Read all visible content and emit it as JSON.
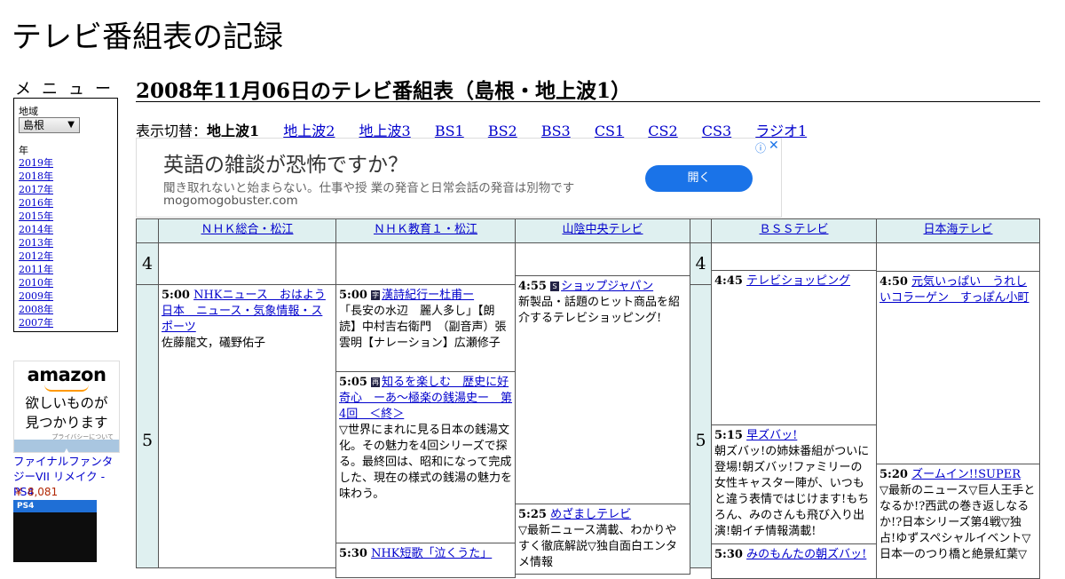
{
  "site_title": "テレビ番組表の記録",
  "sidebar": {
    "menu_heading": "メニュー",
    "region_label": "地域",
    "region_value": "島根",
    "year_label": "年",
    "years": [
      "2019年",
      "2018年",
      "2017年",
      "2016年",
      "2015年",
      "2014年",
      "2013年",
      "2012年",
      "2011年",
      "2010年",
      "2009年",
      "2008年",
      "2007年"
    ]
  },
  "amazon_ad": {
    "logo": "amazon",
    "copy_line1": "欲しいものが",
    "copy_line2": "見つかります",
    "privacy": "プライバシーについて",
    "product_title": "ファイナルファンタジーVII リメイク - PS4",
    "product_price": "￥ 8,081",
    "product_badge": "PS4"
  },
  "page_heading": "2008年11月06日のテレビ番組表（島根・地上波1）",
  "switcher": {
    "label": "表示切替：",
    "current": "地上波1",
    "links": [
      "地上波2",
      "地上波3",
      "BS1",
      "BS2",
      "BS3",
      "CS1",
      "CS2",
      "CS3",
      "ラジオ1"
    ]
  },
  "banner_ad": {
    "headline": "英語の雑談が恐怖ですか？",
    "description": "聞き取れないと始まらない。仕事や授 業の発音と日常会話の発音は別物です",
    "domain": "mogomogobuster.com",
    "button": "開く",
    "info_icon": "ⓘ",
    "close_icon": "✕"
  },
  "schedule": {
    "hours": [
      "4",
      "5"
    ],
    "channels": [
      "ＮＨＫ総合・松江",
      "ＮＨＫ教育１・松江",
      "山陰中央テレビ",
      "ＢＳＳテレビ",
      "日本海テレビ"
    ],
    "programs": {
      "nhk_sogo": [
        {
          "time": "5:00",
          "title": "NHKニュース　おはよう日本　ニュース・気象情報・スポーツ",
          "desc": "佐藤龍文，礒野佑子"
        }
      ],
      "nhk_kyoiku": [
        {
          "time": "5:00",
          "icon": "字",
          "title": "漢詩紀行ー杜甫ー",
          "desc": "「長安の水辺　麗人多し」【朗読】中村吉右衛門　（副音声）張　雲明【ナレーション】広瀬修子"
        },
        {
          "time": "5:05",
          "icon": "再",
          "title": "知るを楽しむ　歴史に好奇心　ーあ～極楽の銭湯史ー　第4回　＜終＞",
          "desc": "▽世界にまれに見る日本の銭湯文化。その魅力を4回シリーズで探る。最終回は、昭和になって完成した、現在の様式の銭湯の魅力を味わう。"
        },
        {
          "time": "5:30",
          "title": "NHK短歌「泣くうた」",
          "desc": ""
        }
      ],
      "sanin_chuo": [
        {
          "time": "4:55",
          "icon": "S",
          "title": "ショップジャパン",
          "desc": "新製品・話題のヒット商品を紹介するテレビショッピング!"
        },
        {
          "time": "5:25",
          "title": "めざましテレビ",
          "desc": "▽最新ニュース満載、わかりやすく徹底解説▽独自面白エンタメ情報"
        }
      ],
      "bss": [
        {
          "time": "4:45",
          "title": "テレビショッピング",
          "desc": ""
        },
        {
          "time": "5:15",
          "title": "早ズバッ!",
          "desc": "朝ズバッ!の姉妹番組がついに登場!朝ズバッ!ファミリーの女性キャスター陣が、いつもと違う表情ではじけます!もちろん、みのさんも飛び入り出演!朝イチ情報満載!"
        },
        {
          "time": "5:30",
          "title": "みのもんたの朝ズバッ!",
          "desc": ""
        }
      ],
      "nihonkai": [
        {
          "time": "4:50",
          "title": "元気いっぱい　うれしいコラーゲン　すっぽん小町",
          "desc": ""
        },
        {
          "time": "5:20",
          "title": "ズームイン!!SUPER",
          "desc": "▽最新のニュース▽巨人王手となるか!?西武の巻き返しなるか!?日本シリーズ第4戦▽独占!ゆずスペシャルイベント▽日本一のつり橋と絶景紅葉▽"
        }
      ]
    }
  }
}
